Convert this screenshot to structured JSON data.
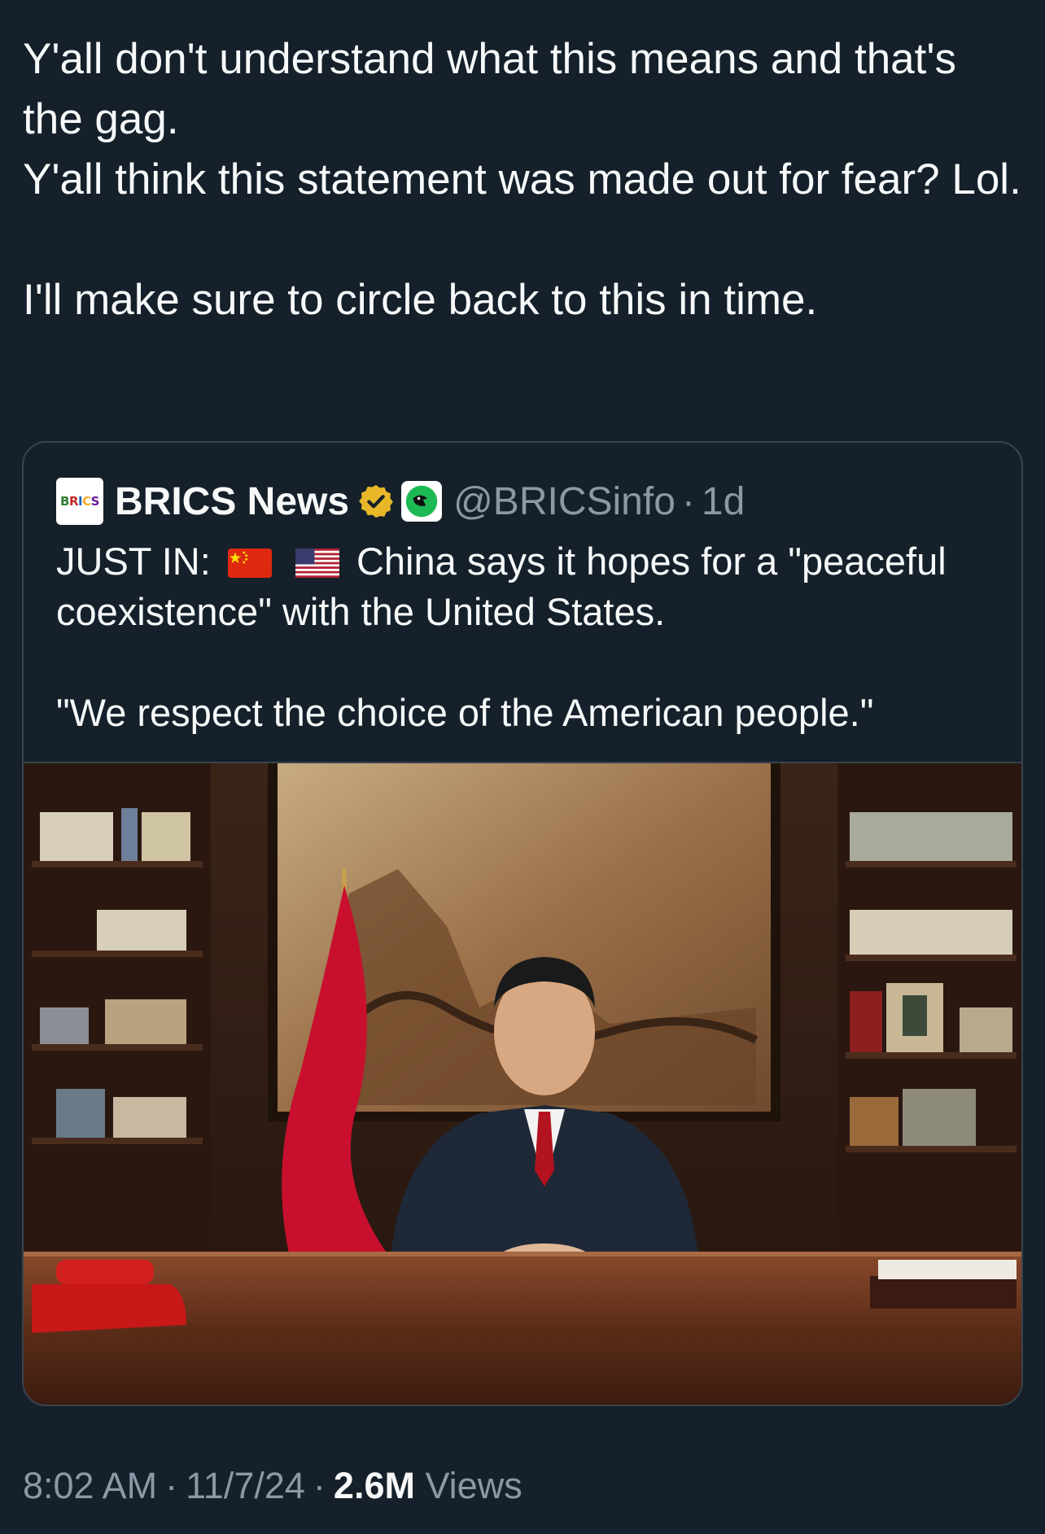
{
  "tweet": {
    "lines": [
      "Y'all don't understand what this means and that's the gag.",
      "Y'all think this statement was made out for fear? Lol.",
      "I'll make sure to circle back to this in time."
    ]
  },
  "quoted": {
    "logo_text": "BRICS",
    "author_name": "BRICS News",
    "verified_badge": "gold-verified-badge-icon",
    "affiliate_icon": "affiliate-bird-icon",
    "handle": "@BRICSinfo",
    "separator": "·",
    "age": "1d",
    "text_prefix": "JUST IN:",
    "flag_1": "china-flag-icon",
    "flag_2": "us-flag-icon",
    "text_main": "China says it hopes for a \"peaceful coexistence\" with the United States.",
    "text_quote": "\"We respect the choice of the American people.\"",
    "media": "photo-of-speaker-at-desk"
  },
  "meta": {
    "time": "8:02 AM",
    "separator": "·",
    "date": "11/7/24",
    "views_count": "2.6M",
    "views_label": "Views"
  },
  "colors": {
    "background": "#15202b",
    "text": "#f7f9f9",
    "secondary": "#8b98a5",
    "border": "#38444d",
    "badge_gold": "#e8b829"
  }
}
